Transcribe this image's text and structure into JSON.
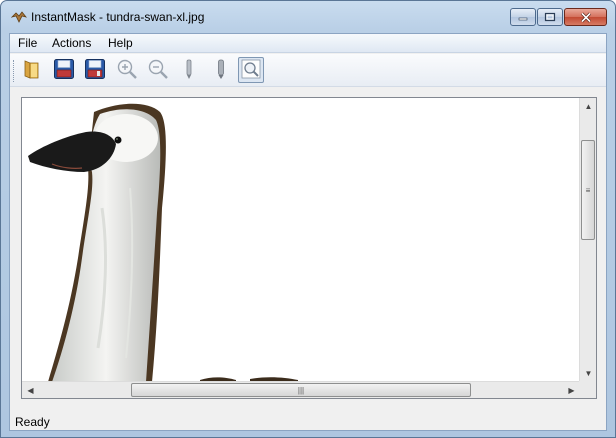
{
  "window": {
    "title": "InstantMask - tundra-swan-xl.jpg",
    "caption_buttons": {
      "minimize": "minimize-icon",
      "maximize": "maximize-icon",
      "close": "close-icon"
    }
  },
  "menu": {
    "items": [
      {
        "label": "File"
      },
      {
        "label": "Actions"
      },
      {
        "label": "Help"
      }
    ]
  },
  "toolbar": {
    "tools": [
      {
        "icon": "open-folder-icon"
      },
      {
        "icon": "save-icon"
      },
      {
        "icon": "save-as-icon"
      },
      {
        "icon": "zoom-in-icon"
      },
      {
        "icon": "zoom-out-icon"
      },
      {
        "icon": "pencil-icon"
      },
      {
        "icon": "marker-icon"
      },
      {
        "icon": "zoom-fit-icon",
        "active": true
      }
    ]
  },
  "canvas": {
    "image": "tundra-swan-xl.jpg",
    "background": "#ffffff"
  },
  "status": {
    "text": "Ready"
  },
  "colors": {
    "title_gradient_top": "#c9dcef",
    "toolbar_bg": "#f0f0f0",
    "save_blue": "#2a5aa8",
    "active_tool_border": "#7f97b3"
  }
}
